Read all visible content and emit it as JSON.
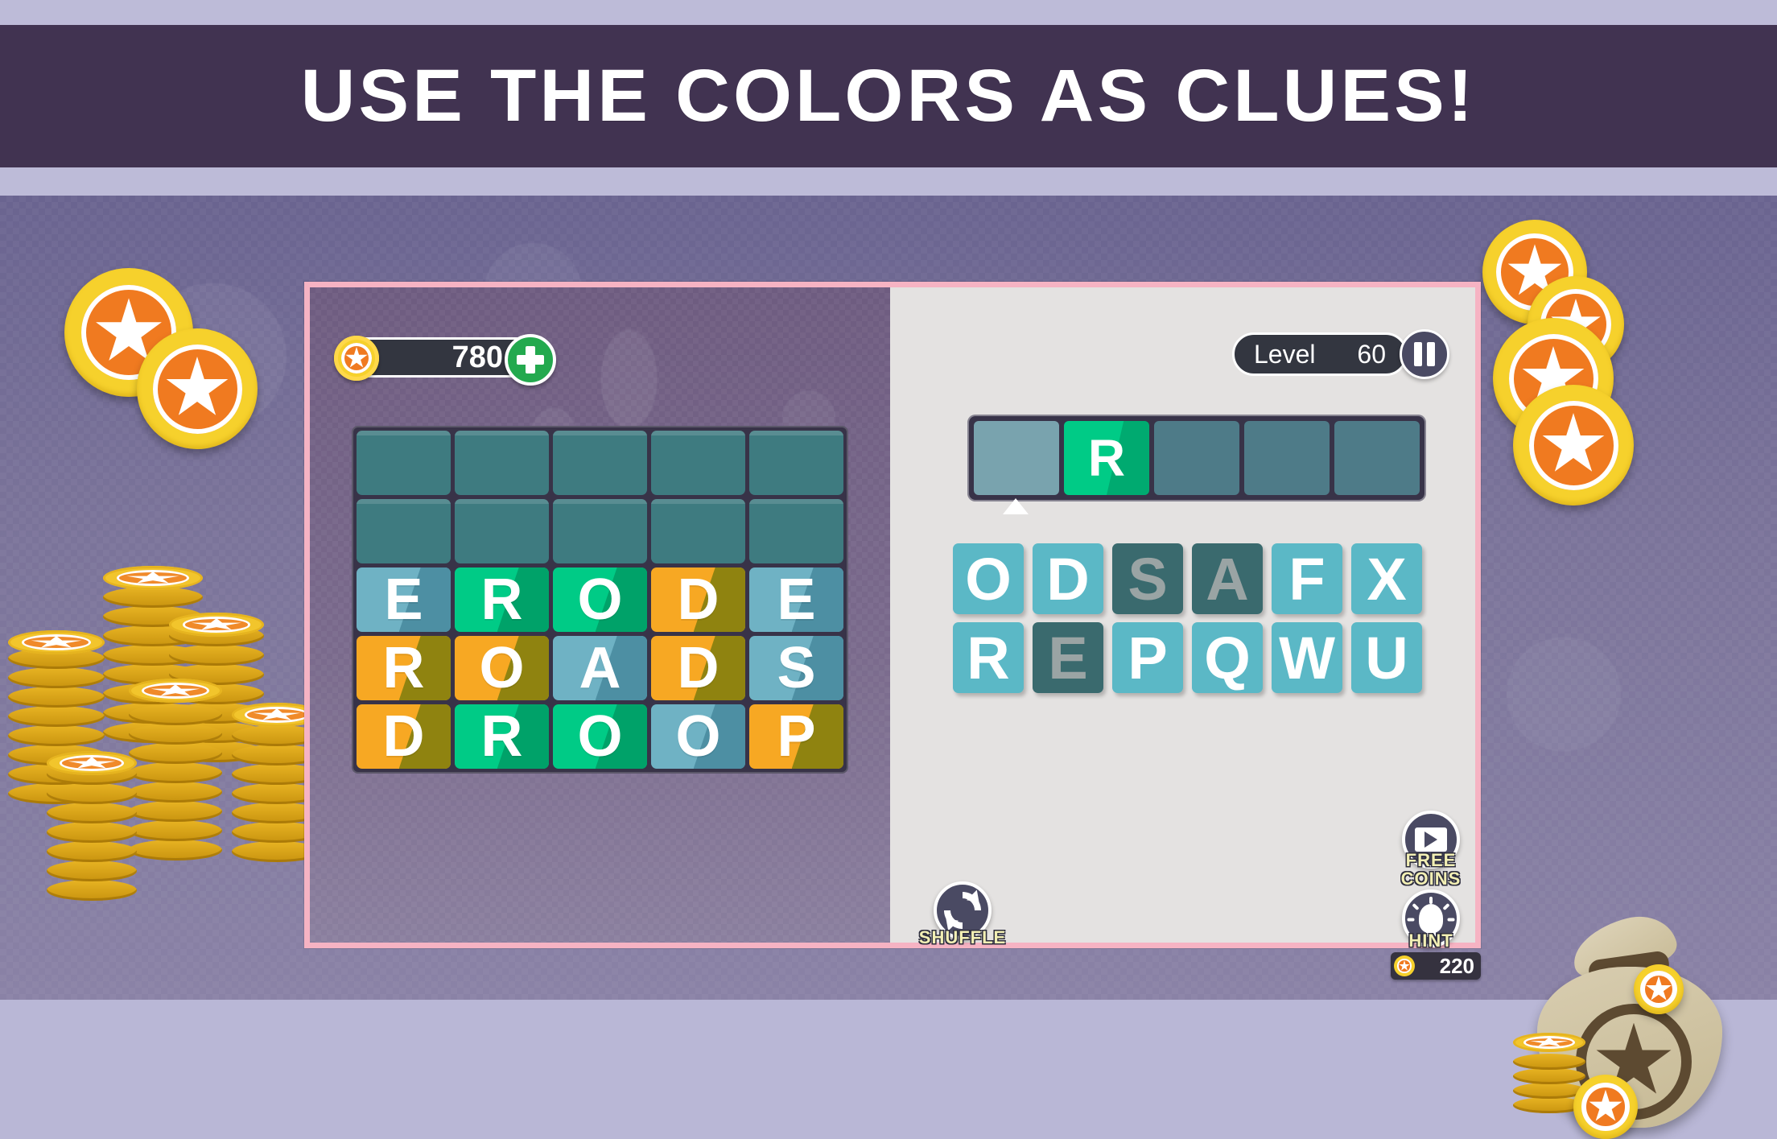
{
  "promo": {
    "headline": "USE THE COLORS AS CLUES!"
  },
  "hud": {
    "coin_icon": "star-coin-icon",
    "coin_value": "780",
    "add_coins_icon": "plus-icon",
    "level_label": "Level",
    "level_number": "60",
    "pause_icon": "pause-icon"
  },
  "grid": {
    "rows": [
      [
        {
          "letter": "",
          "state": "empty"
        },
        {
          "letter": "",
          "state": "empty"
        },
        {
          "letter": "",
          "state": "empty"
        },
        {
          "letter": "",
          "state": "empty"
        },
        {
          "letter": "",
          "state": "empty"
        }
      ],
      [
        {
          "letter": "",
          "state": "empty"
        },
        {
          "letter": "",
          "state": "empty"
        },
        {
          "letter": "",
          "state": "empty"
        },
        {
          "letter": "",
          "state": "empty"
        },
        {
          "letter": "",
          "state": "empty"
        }
      ],
      [
        {
          "letter": "E",
          "state": "blue"
        },
        {
          "letter": "R",
          "state": "green"
        },
        {
          "letter": "O",
          "state": "green"
        },
        {
          "letter": "D",
          "state": "orange"
        },
        {
          "letter": "E",
          "state": "blue"
        }
      ],
      [
        {
          "letter": "R",
          "state": "orange"
        },
        {
          "letter": "O",
          "state": "orange"
        },
        {
          "letter": "A",
          "state": "blue"
        },
        {
          "letter": "D",
          "state": "orange"
        },
        {
          "letter": "S",
          "state": "blue"
        }
      ],
      [
        {
          "letter": "D",
          "state": "orange"
        },
        {
          "letter": "R",
          "state": "green"
        },
        {
          "letter": "O",
          "state": "green"
        },
        {
          "letter": "O",
          "state": "blue"
        },
        {
          "letter": "P",
          "state": "orange"
        }
      ]
    ],
    "solved_words": [
      "ERODE",
      "ROADS",
      "DROOP"
    ]
  },
  "answer_tray": {
    "slots": [
      {
        "letter": "",
        "state": "active"
      },
      {
        "letter": "R",
        "state": "filled"
      },
      {
        "letter": "",
        "state": "blank"
      },
      {
        "letter": "",
        "state": "blank"
      },
      {
        "letter": "",
        "state": "blank"
      }
    ]
  },
  "keyboard": {
    "rows": [
      [
        {
          "letter": "O",
          "state": "avail"
        },
        {
          "letter": "D",
          "state": "avail"
        },
        {
          "letter": "S",
          "state": "used"
        },
        {
          "letter": "A",
          "state": "used"
        },
        {
          "letter": "F",
          "state": "avail"
        },
        {
          "letter": "X",
          "state": "avail"
        }
      ],
      [
        {
          "letter": "R",
          "state": "avail"
        },
        {
          "letter": "E",
          "state": "used"
        },
        {
          "letter": "P",
          "state": "avail"
        },
        {
          "letter": "Q",
          "state": "avail"
        },
        {
          "letter": "W",
          "state": "avail"
        },
        {
          "letter": "U",
          "state": "avail"
        }
      ]
    ]
  },
  "actions": {
    "shuffle_label": "SHUFFLE",
    "shuffle_icon": "shuffle-arrows-icon",
    "free_coins_label_line1": "FREE",
    "free_coins_label_line2": "COINS",
    "free_coins_icon": "video-play-icon",
    "hint_label": "HINT",
    "hint_icon": "lightbulb-icon",
    "hint_cost": "220",
    "hint_cost_icon": "star-coin-icon"
  },
  "colors": {
    "banner_bg": "#413351",
    "frame_border": "#f6b3c3",
    "left_panel": "#7a6a8c",
    "right_panel": "#e4e2e1",
    "tile_blue": "#6fb2c4",
    "tile_green": "#00cb86",
    "tile_orange": "#f7a823",
    "tile_empty": "#3e7b80",
    "key_avail": "#5bb8c6",
    "key_used": "#3a6a6e",
    "coin_gold": "#f6d12c",
    "coin_orange": "#f07a20",
    "add_green": "#23a94e",
    "caption_yellow": "#f2efb4"
  },
  "decor": {
    "coins_top_left": "coin-pair-icon",
    "coins_top_right": "coin-pair-icon",
    "coins_right": "coin-pair-icon",
    "coin_stacks": "coin-stack-icon",
    "money_bag": "money-bag-icon"
  }
}
